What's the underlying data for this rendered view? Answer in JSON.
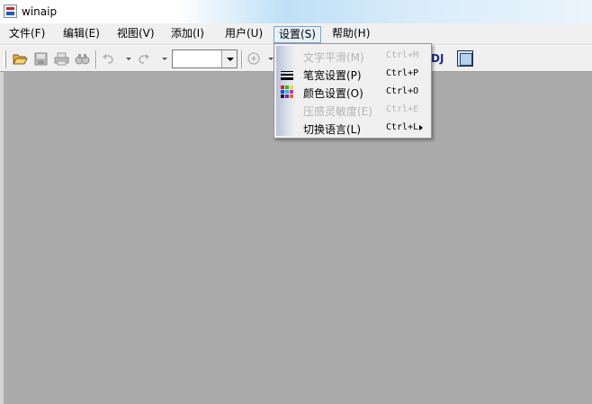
{
  "window": {
    "title": "winaip",
    "app_icon": "app-icon"
  },
  "menubar": {
    "items": [
      {
        "label": "文件(F)",
        "active": false
      },
      {
        "label": "编辑(E)",
        "active": false
      },
      {
        "label": "视图(V)",
        "active": false
      },
      {
        "label": "添加(I)",
        "active": false
      },
      {
        "label": "用户(U)",
        "active": false
      },
      {
        "label": "设置(S)",
        "active": true
      },
      {
        "label": "帮助(H)",
        "active": false
      }
    ]
  },
  "toolbar": {
    "icons": [
      "open-folder-icon",
      "save-icon",
      "print-icon",
      "find-icon",
      "undo-icon",
      "redo-icon",
      "zoom-in-icon",
      "document-icon"
    ],
    "zoom_value": "",
    "dj_label": "DJ"
  },
  "settings_menu": {
    "items": [
      {
        "label": "文字平滑(M)",
        "shortcut": "Ctrl+M",
        "enabled": false,
        "icon": ""
      },
      {
        "label": "笔宽设置(P)",
        "shortcut": "Ctrl+P",
        "enabled": true,
        "icon": "pen-width-icon"
      },
      {
        "label": "颜色设置(O)",
        "shortcut": "Ctrl+O",
        "enabled": true,
        "icon": "color-palette-icon"
      },
      {
        "label": "压感灵敏度(E)",
        "shortcut": "Ctrl+E",
        "enabled": false,
        "icon": ""
      },
      {
        "label": "切换语言(L)",
        "shortcut": "Ctrl+L",
        "enabled": true,
        "icon": "",
        "submenu": true
      }
    ]
  },
  "colors": {
    "workspace": "#ababab",
    "menu_background": "#f0f0f0",
    "active_menu_highlight": "#e5f1fb",
    "disabled_text": "#b4b4b4"
  }
}
